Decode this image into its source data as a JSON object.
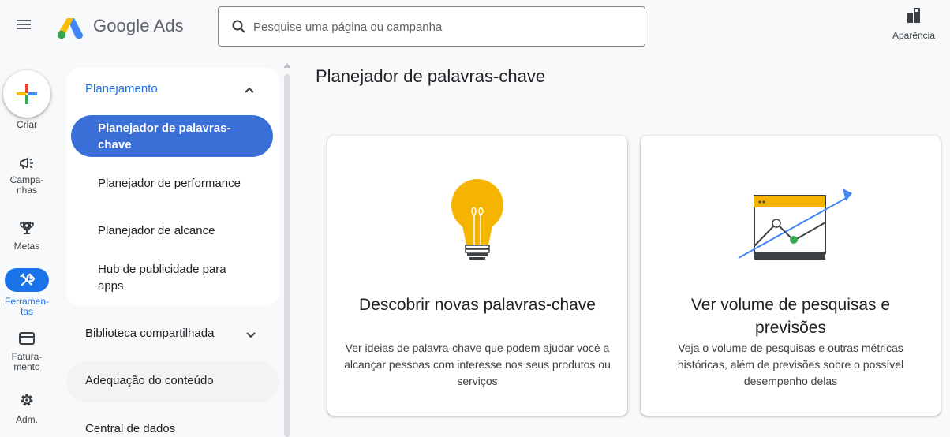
{
  "header": {
    "brand": "Google Ads",
    "search_placeholder": "Pesquise uma página ou campanha",
    "appearance_label": "Aparência"
  },
  "rail": {
    "create_label": "Criar",
    "campaigns_label": "Campa-\nnhas",
    "goals_label": "Metas",
    "tools_label": "Ferramen-\ntas",
    "billing_label": "Fatura-\nmento",
    "admin_label": "Adm."
  },
  "nav": {
    "section_title": "Planejamento",
    "items": [
      {
        "label": "Planejador de palavras-chave"
      },
      {
        "label": "Planejador de performance"
      },
      {
        "label": "Planejador de alcance"
      },
      {
        "label": "Hub de publicidade para apps"
      }
    ],
    "shared_library": "Biblioteca compartilhada",
    "content_suitability": "Adequação do conteúdo",
    "data_hub": "Central de dados"
  },
  "main": {
    "page_title": "Planejador de palavras-chave",
    "cards": [
      {
        "title": "Descobrir novas palavras-chave",
        "description": "Ver ideias de palavra-chave que podem ajudar você a alcançar pessoas com interesse nos seus produtos ou serviços",
        "icon": "lightbulb-icon"
      },
      {
        "title": "Ver volume de pesquisas e previsões",
        "description": "Veja o volume de pesquisas e outras métricas históricas, além de previsões sobre o possível desempenho delas",
        "icon": "trend-chart-icon"
      }
    ]
  },
  "colors": {
    "accent": "#1a73e8",
    "selected_nav": "#3a6fd8",
    "bulb": "#f4b400",
    "green": "#34a853"
  }
}
